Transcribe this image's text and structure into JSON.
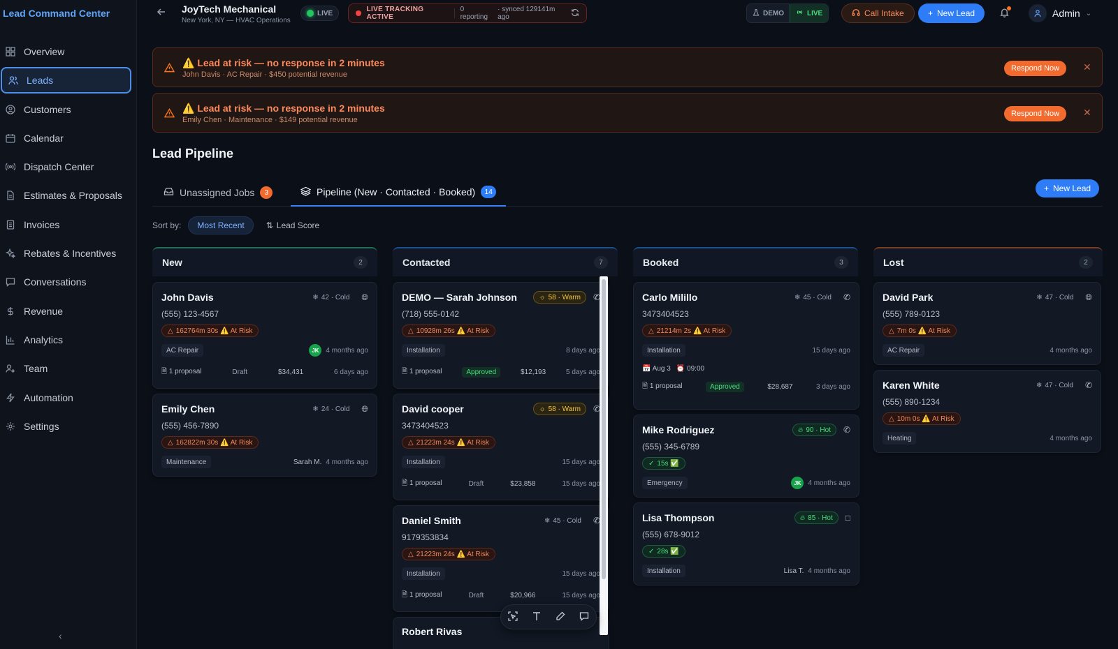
{
  "sidebar": {
    "brand": "Lead Command Center",
    "items": [
      {
        "label": "Overview"
      },
      {
        "label": "Leads"
      },
      {
        "label": "Customers"
      },
      {
        "label": "Calendar"
      },
      {
        "label": "Dispatch Center"
      },
      {
        "label": "Estimates & Proposals"
      },
      {
        "label": "Invoices"
      },
      {
        "label": "Rebates & Incentives"
      },
      {
        "label": "Conversations"
      },
      {
        "label": "Revenue"
      },
      {
        "label": "Analytics"
      },
      {
        "label": "Team"
      },
      {
        "label": "Automation"
      },
      {
        "label": "Settings"
      }
    ],
    "active_index": 1
  },
  "topbar": {
    "company_name": "JoyTech Mechanical",
    "company_sub": "New York, NY — HVAC Operations",
    "live_label": "LIVE",
    "tracking_label": "LIVE TRACKING ACTIVE",
    "reporting": "0 reporting",
    "synced": "· synced 129141m ago",
    "mode_demo": "DEMO",
    "mode_live": "LIVE",
    "call_intake": "Call Intake",
    "new_lead": "New Lead",
    "admin": "Admin"
  },
  "alerts": [
    {
      "title": "⚠️ Lead at risk — no response in 2 minutes",
      "sub": "John Davis · AC Repair · $450 potential revenue",
      "action": "Respond Now"
    },
    {
      "title": "⚠️ Lead at risk — no response in 2 minutes",
      "sub": "Emily Chen · Maintenance · $149 potential revenue",
      "action": "Respond Now"
    }
  ],
  "page": {
    "title": "Lead Pipeline",
    "tab_unassigned": "Unassigned Jobs",
    "tab_unassigned_count": "3",
    "tab_pipeline": "Pipeline (New · Contacted · Booked)",
    "tab_pipeline_count": "14",
    "new_lead": "New Lead",
    "sort_by": "Sort by:",
    "sort_recent": "Most Recent",
    "sort_score": "Lead Score"
  },
  "columns": {
    "new": {
      "title": "New",
      "count": "2",
      "color": "#1f6f55"
    },
    "contacted": {
      "title": "Contacted",
      "count": "7",
      "color": "#1d4f8f"
    },
    "booked": {
      "title": "Booked",
      "count": "3",
      "color": "#1d4f8f"
    },
    "lost": {
      "title": "Lost",
      "count": "2",
      "color": "#7a3d22"
    }
  },
  "cards": {
    "john": {
      "name": "John Davis",
      "score": "42 · Cold",
      "phone": "(555) 123-4567",
      "risk": "162764m 30s ⚠️ At Risk",
      "tag": "AC Repair",
      "assignee": "JK",
      "age": "4 months ago",
      "proposals": "1 proposal",
      "status": "Draft",
      "amount": "$34,431",
      "proposal_age": "6 days ago"
    },
    "emily": {
      "name": "Emily Chen",
      "score": "24 · Cold",
      "phone": "(555) 456-7890",
      "risk": "162822m 30s ⚠️ At Risk",
      "tag": "Maintenance",
      "assignee": "Sarah M.",
      "age": "4 months ago"
    },
    "sarah": {
      "name": "DEMO — Sarah Johnson",
      "score": "58 · Warm",
      "phone": "(718) 555-0142",
      "risk": "10928m 26s ⚠️ At Risk",
      "tag": "Installation",
      "age": "8 days ago",
      "proposals": "1 proposal",
      "status": "Approved",
      "amount": "$12,193",
      "proposal_age": "5 days ago"
    },
    "david_c": {
      "name": "David cooper",
      "score": "58 · Warm",
      "phone": "3473404523",
      "risk": "21223m 24s ⚠️ At Risk",
      "tag": "Installation",
      "age": "15 days ago",
      "proposals": "1 proposal",
      "status": "Draft",
      "amount": "$23,858",
      "proposal_age": "15 days ago"
    },
    "daniel": {
      "name": "Daniel Smith",
      "score": "45 · Cold",
      "phone": "9179353834",
      "risk": "21223m 24s ⚠️ At Risk",
      "tag": "Installation",
      "age": "15 days ago",
      "proposals": "1 proposal",
      "status": "Draft",
      "amount": "$20,966",
      "proposal_age": "15 days ago"
    },
    "robert": {
      "name": "Robert Rivas"
    },
    "carlo": {
      "name": "Carlo Milillo",
      "score": "45 · Cold",
      "phone": "3473404523",
      "risk": "21214m 2s ⚠️ At Risk",
      "tag": "Installation",
      "age": "15 days ago",
      "date": "📅 Aug 3",
      "time": "⏰ 09:00",
      "proposals": "1 proposal",
      "status": "Approved",
      "amount": "$28,687",
      "proposal_age": "3 days ago"
    },
    "mike": {
      "name": "Mike Rodriguez",
      "score": "90 · Hot",
      "phone": "(555) 345-6789",
      "ok": "15s ✅",
      "tag": "Emergency",
      "assignee": "JK",
      "age": "4 months ago"
    },
    "lisa": {
      "name": "Lisa Thompson",
      "score": "85 · Hot",
      "phone": "(555) 678-9012",
      "ok": "28s ✅",
      "tag": "Installation",
      "assignee": "Lisa T.",
      "age": "4 months ago"
    },
    "david_p": {
      "name": "David Park",
      "score": "47 · Cold",
      "phone": "(555) 789-0123",
      "risk": "7m 0s ⚠️ At Risk",
      "tag": "AC Repair",
      "age": "4 months ago"
    },
    "karen": {
      "name": "Karen White",
      "score": "47 · Cold",
      "phone": "(555) 890-1234",
      "risk": "10m 0s ⚠️ At Risk",
      "tag": "Heating",
      "age": "4 months ago"
    }
  }
}
